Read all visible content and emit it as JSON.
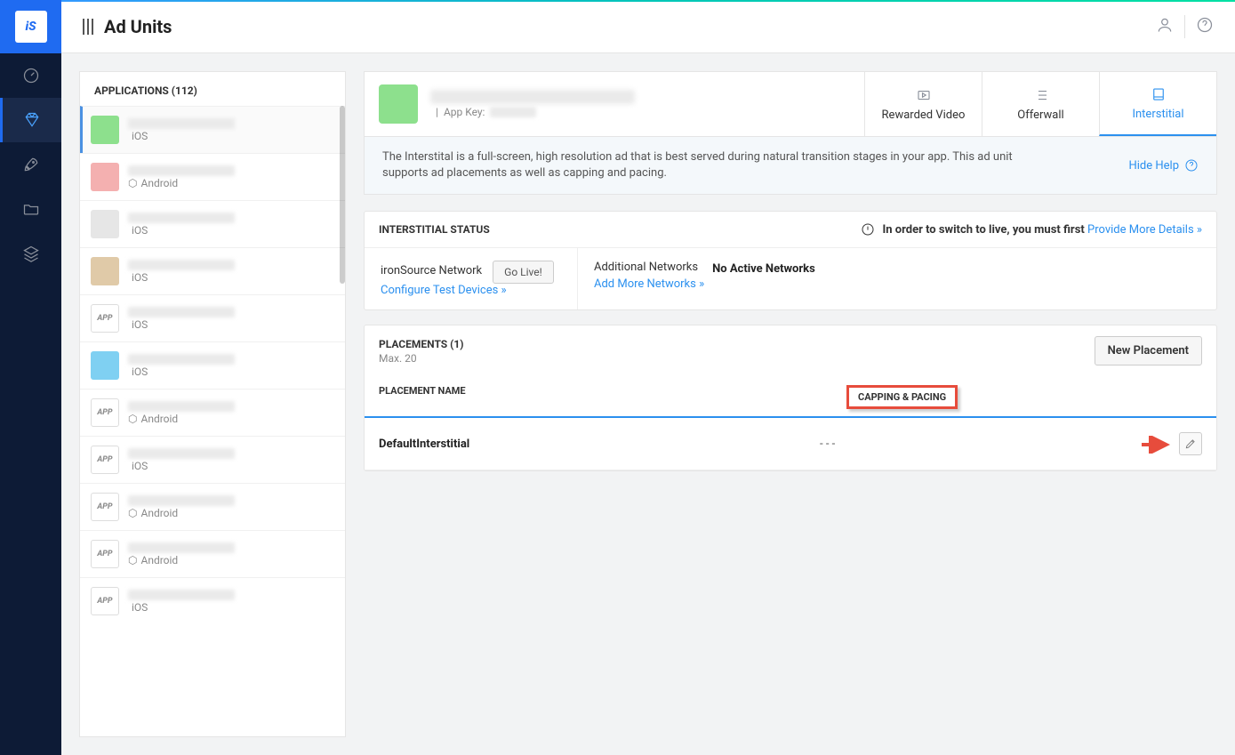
{
  "header": {
    "page_title": "Ad Units"
  },
  "sidebar": {
    "applications_label": "APPLICATIONS (112)",
    "apps": [
      {
        "platform": "iOS",
        "color": "#8de08d",
        "selected": true,
        "generic": false
      },
      {
        "platform": "Android",
        "color": "#f4b0b0",
        "selected": false,
        "generic": false
      },
      {
        "platform": "iOS",
        "color": "#e6e6e6",
        "selected": false,
        "generic": false
      },
      {
        "platform": "iOS",
        "color": "#e0caa8",
        "selected": false,
        "generic": false
      },
      {
        "platform": "iOS",
        "color": "#ffffff",
        "selected": false,
        "generic": true
      },
      {
        "platform": "iOS",
        "color": "#7fd0f2",
        "selected": false,
        "generic": false
      },
      {
        "platform": "Android",
        "color": "#ffffff",
        "selected": false,
        "generic": true
      },
      {
        "platform": "iOS",
        "color": "#ffffff",
        "selected": false,
        "generic": true
      },
      {
        "platform": "Android",
        "color": "#ffffff",
        "selected": false,
        "generic": true
      },
      {
        "platform": "Android",
        "color": "#ffffff",
        "selected": false,
        "generic": true
      },
      {
        "platform": "iOS",
        "color": "#ffffff",
        "selected": false,
        "generic": true
      }
    ]
  },
  "app_detail": {
    "app_key_label": "App Key:"
  },
  "tabs": {
    "rewarded": "Rewarded Video",
    "offerwall": "Offerwall",
    "interstitial": "Interstitial"
  },
  "help": {
    "text": "The Interstital is a full-screen, high resolution ad that is best served during natural transition stages in your app. This ad unit supports ad placements as well as capping and pacing.",
    "hide_label": "Hide Help"
  },
  "status": {
    "title": "INTERSTITIAL STATUS",
    "warning_prefix": "In order to switch to live, you must first",
    "warning_link": "Provide More Details »",
    "network_label": "ironSource Network",
    "go_live_label": "Go Live!",
    "configure_link": "Configure Test Devices »",
    "additional_label": "Additional Networks",
    "no_active_label": "No Active Networks",
    "add_more_link": "Add More Networks »"
  },
  "placements": {
    "title": "PLACEMENTS (1)",
    "max_label": "Max. 20",
    "new_button": "New Placement",
    "columns": {
      "name": "PLACEMENT NAME",
      "capping": "CAPPING & PACING"
    },
    "rows": [
      {
        "name": "DefaultInterstitial",
        "capping": "- - -"
      }
    ]
  }
}
